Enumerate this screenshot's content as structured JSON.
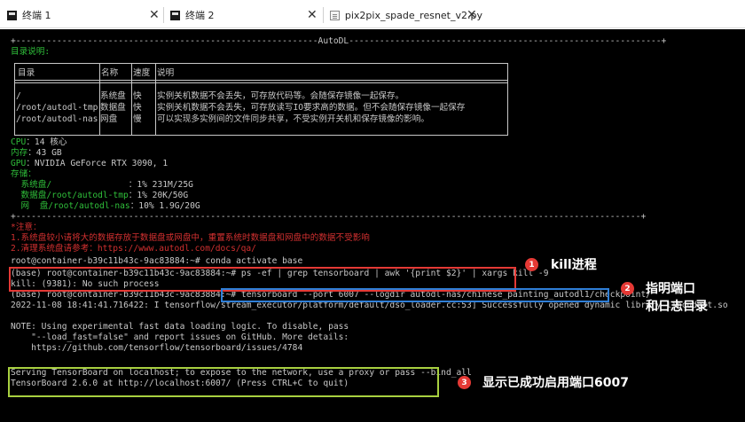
{
  "tabs": [
    {
      "label": "终端 1",
      "icon": "terminal-icon",
      "active": false
    },
    {
      "label": "终端 2",
      "icon": "terminal-icon",
      "active": true
    },
    {
      "label": "pix2pix_spade_resnet_v2.py",
      "icon": "file-icon",
      "active": false
    }
  ],
  "close_glyph": "✕",
  "colors": {
    "terminal_bg": "#000000",
    "text": "#c8c8c8",
    "green": "#2fbf3a",
    "red": "#d23030",
    "box_red": "#e53935",
    "box_blue": "#2f7fd8",
    "box_green": "#a8d040"
  },
  "terminal": {
    "banner": "+-----------------------------------------------------------AutoDL-------------------------------------------------------------+",
    "dir_title": "目录说明:",
    "table": {
      "headers": [
        "目录",
        "名称",
        "速度",
        "说明"
      ],
      "rows": [
        [
          "/",
          "系统盘",
          "快",
          "实例关机数据不会丢失，可存放代码等。会随保存镜像一起保存。"
        ],
        [
          "/root/autodl-tmp",
          "数据盘",
          "快",
          "实例关机数据不会丢失，可存放读写IO要求高的数据。但不会随保存镜像一起保存"
        ],
        [
          "/root/autodl-nas",
          "网盘",
          "慢",
          "可以实现多实例间的文件同步共享，不受实例开关机和保存镜像的影响。"
        ]
      ]
    },
    "cpu_label": "CPU",
    "cpu_value": "：14 核心",
    "mem_label": "内存",
    "mem_value": "：43 GB",
    "gpu_label": "GPU",
    "gpu_value": "：NVIDIA GeForce RTX 3090, 1",
    "storage_label": "存储：",
    "sys_disk_label": "  系统盘/               ",
    "sys_disk_value": "：1% 231M/25G",
    "data_disk_label": "  数据盘/root/autodl-tmp",
    "data_disk_value": "：1% 20K/50G",
    "net_disk_label": "  网  盘/root/autodl-nas",
    "net_disk_value": "：10% 1.9G/20G",
    "banner2": "+--------------------------------------------------------------------------------------------------------------------------+",
    "attention": "*注意：",
    "attention_1": "1.系统盘较小请将大的数据存放于数据盘或网盘中，重置系统时数据盘和网盘中的数据不受影响",
    "attention_2": "2.清理系统盘请参考：https://www.autodl.com/docs/qa/",
    "cmd_conda": "root@container-b39c11b43c-9ac83884:~# conda activate base",
    "cmd_kill": "(base) root@container-b39c11b43c-9ac83884:~# ps -ef | grep tensorboard | awk '{print $2}' | xargs kill -9",
    "kill_result": "kill: (9381): No such process",
    "cmd_tb_prompt": "(base) root@container-b39c11b43c-9ac83884:~# ",
    "cmd_tb": "tensorboard --port 6007 --logdir autodl-nas/chinese_painting_autodl1/checkpoint/",
    "tf_log": "2022-11-08 18:41:41.716422: I tensorflow/stream_executor/platform/default/dso_loader.cc:53] Successfully opened dynamic library libcudart.so",
    "note_1": "NOTE: Using experimental fast data loading logic. To disable, pass",
    "note_2": "    \"--load_fast=false\" and report issues on GitHub. More details:",
    "note_3": "    https://github.com/tensorflow/tensorboard/issues/4784",
    "serving_1": "Serving TensorBoard on localhost; to expose to the network, use a proxy or pass --bind_all",
    "serving_2": "TensorBoard 2.6.0 at http://localhost:6007/ (Press CTRL+C to quit)"
  },
  "annotations": [
    {
      "number": "1",
      "text": "kill进程"
    },
    {
      "number": "2",
      "text": "指明端口\n和日志目录"
    },
    {
      "number": "3",
      "text": "显示已成功启用端口6007"
    }
  ]
}
